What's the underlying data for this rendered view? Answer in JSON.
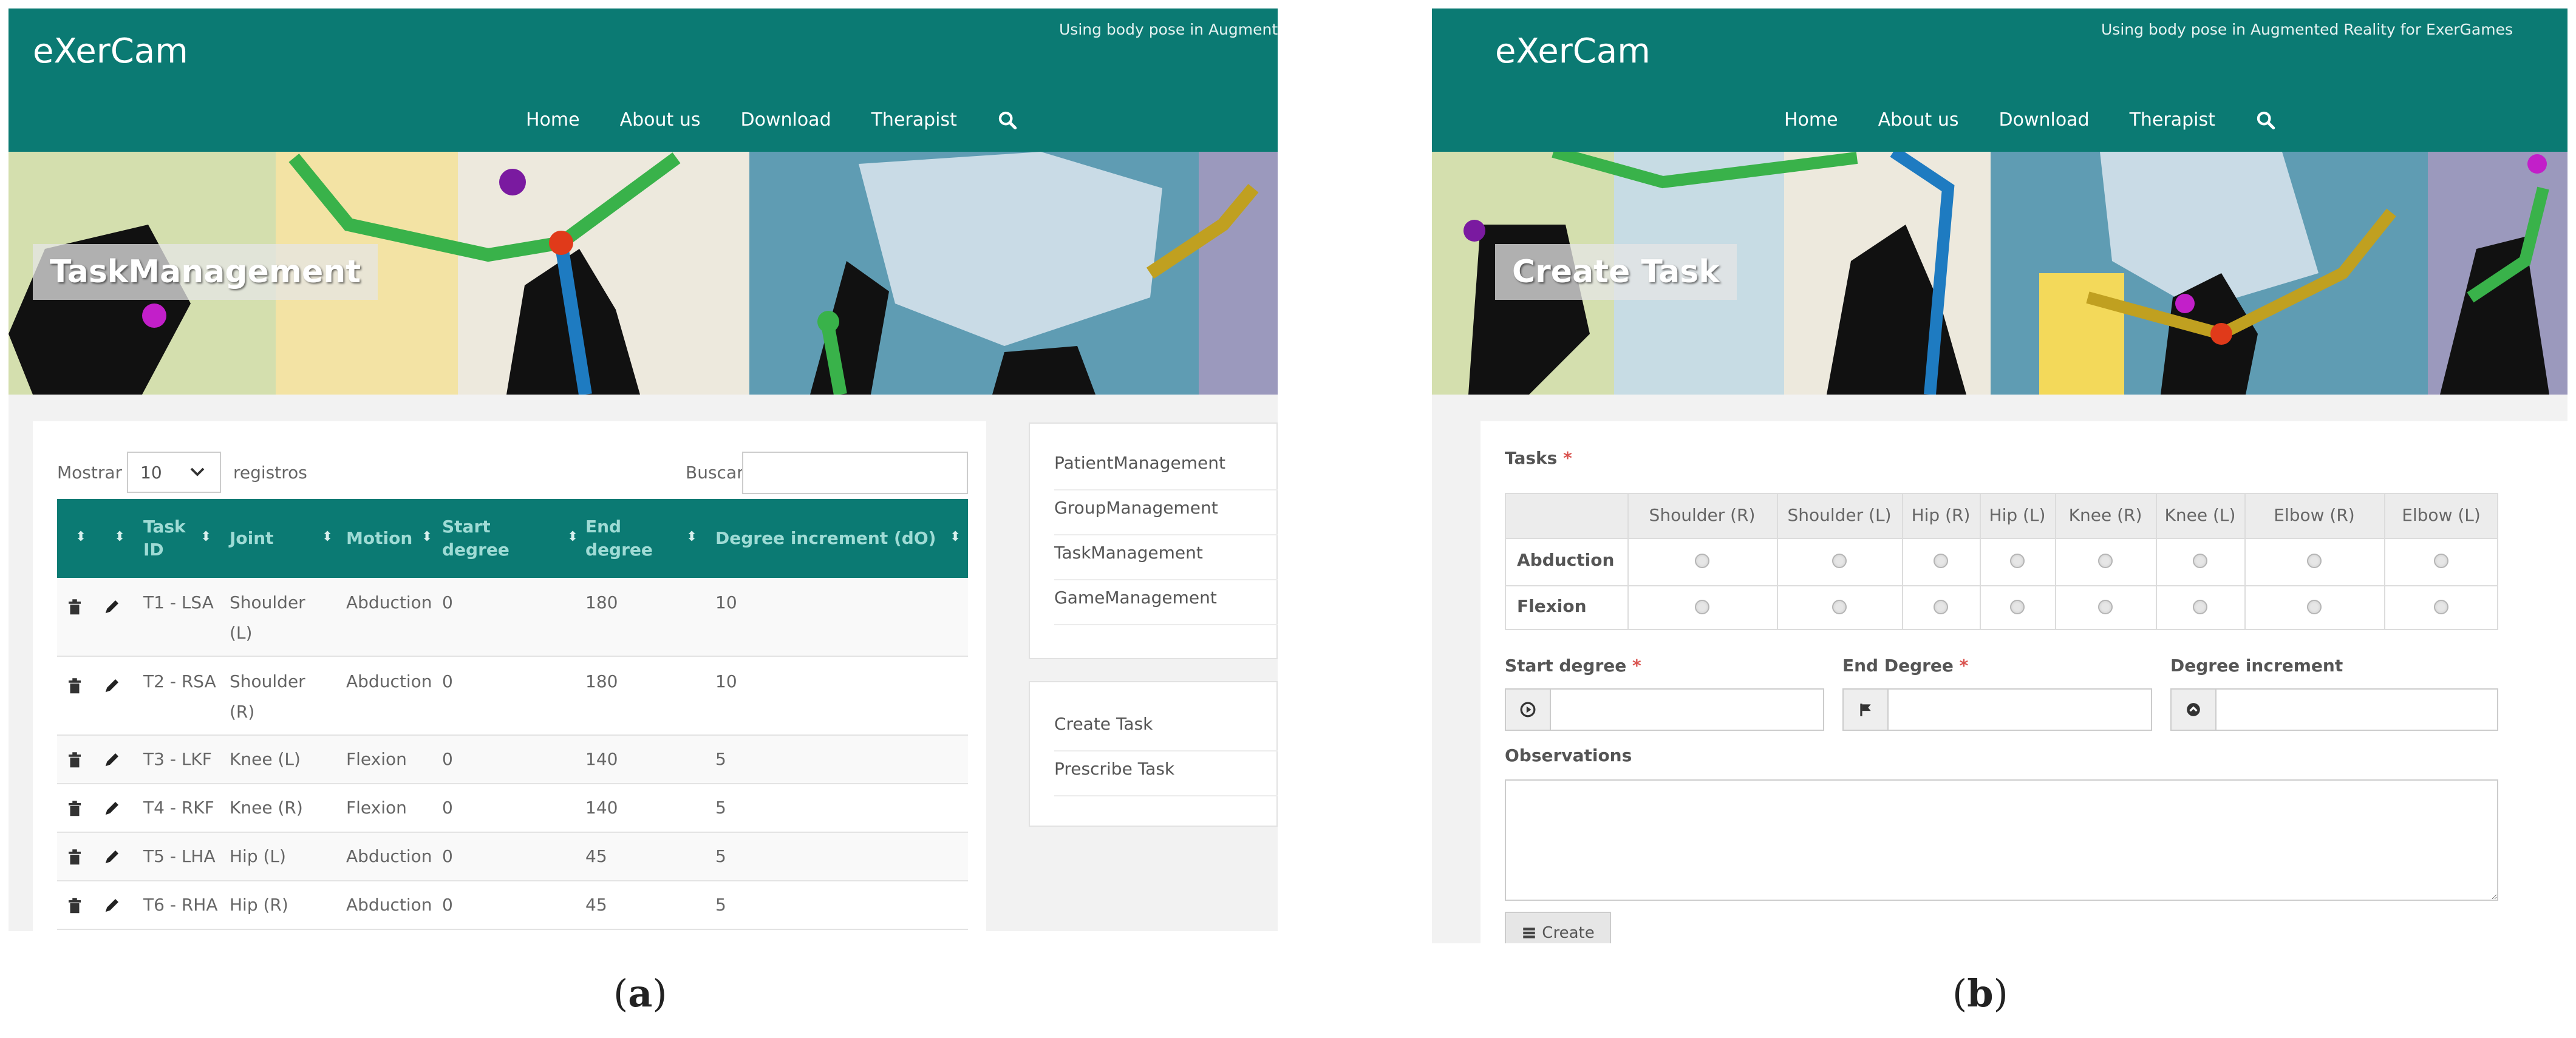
{
  "shared": {
    "brand": "eXerCam",
    "nav": [
      "Home",
      "About us",
      "Download",
      "Therapist"
    ],
    "accent_color": "#0b7a73",
    "search_icon": "search-icon"
  },
  "screen_a": {
    "tagline": "Using body pose in Augment",
    "banner_title": "TaskManagement",
    "length_label": "Mostrar",
    "length_value": "10",
    "length_suffix": "registros",
    "search_label": "Buscar:",
    "search_value": "",
    "columns": {
      "task_id": "Task ID",
      "joint": "Joint",
      "motion": "Motion",
      "start": "Start degree",
      "end": "End degree",
      "increment": "Degree increment (dO)"
    },
    "rows": [
      {
        "id": "T1 - LSA",
        "joint": "Shoulder (L)",
        "motion": "Abduction",
        "start": "0",
        "end": "180",
        "inc": "10"
      },
      {
        "id": "T2 - RSA",
        "joint": "Shoulder (R)",
        "motion": "Abduction",
        "start": "0",
        "end": "180",
        "inc": "10"
      },
      {
        "id": "T3 - LKF",
        "joint": "Knee (L)",
        "motion": "Flexion",
        "start": "0",
        "end": "140",
        "inc": "5"
      },
      {
        "id": "T4 - RKF",
        "joint": "Knee (R)",
        "motion": "Flexion",
        "start": "0",
        "end": "140",
        "inc": "5"
      },
      {
        "id": "T5 - LHA",
        "joint": "Hip (L)",
        "motion": "Abduction",
        "start": "0",
        "end": "45",
        "inc": "5"
      },
      {
        "id": "T6 - RHA",
        "joint": "Hip (R)",
        "motion": "Abduction",
        "start": "0",
        "end": "45",
        "inc": "5"
      }
    ],
    "row_icons": [
      "trash-icon",
      "pencil-icon"
    ],
    "sidebar_main": [
      "PatientManagement",
      "GroupManagement",
      "TaskManagement",
      "GameManagement"
    ],
    "sidebar_tasks": [
      "Create Task",
      "Prescribe Task"
    ]
  },
  "screen_b": {
    "tagline": "Using body pose in Augmented Reality for ExerGames",
    "banner_title": "Create Task",
    "tasks_label": "Tasks",
    "required_mark": "*",
    "joints": [
      "Shoulder (R)",
      "Shoulder (L)",
      "Hip (R)",
      "Hip (L)",
      "Knee (R)",
      "Knee (L)",
      "Elbow (R)",
      "Elbow (L)"
    ],
    "motions": [
      "Abduction",
      "Flexion"
    ],
    "start_label": "Start degree",
    "end_label": "End Degree",
    "increment_label": "Degree increment",
    "start_value": "",
    "end_value": "",
    "increment_value": "",
    "observations_label": "Observations",
    "observations_value": "",
    "create_label": "Create",
    "field_icons": [
      "play-circle-icon",
      "flag-icon",
      "chevron-circle-icon"
    ],
    "create_icon": "list-icon"
  },
  "captions": {
    "a": "a",
    "b": "b"
  }
}
